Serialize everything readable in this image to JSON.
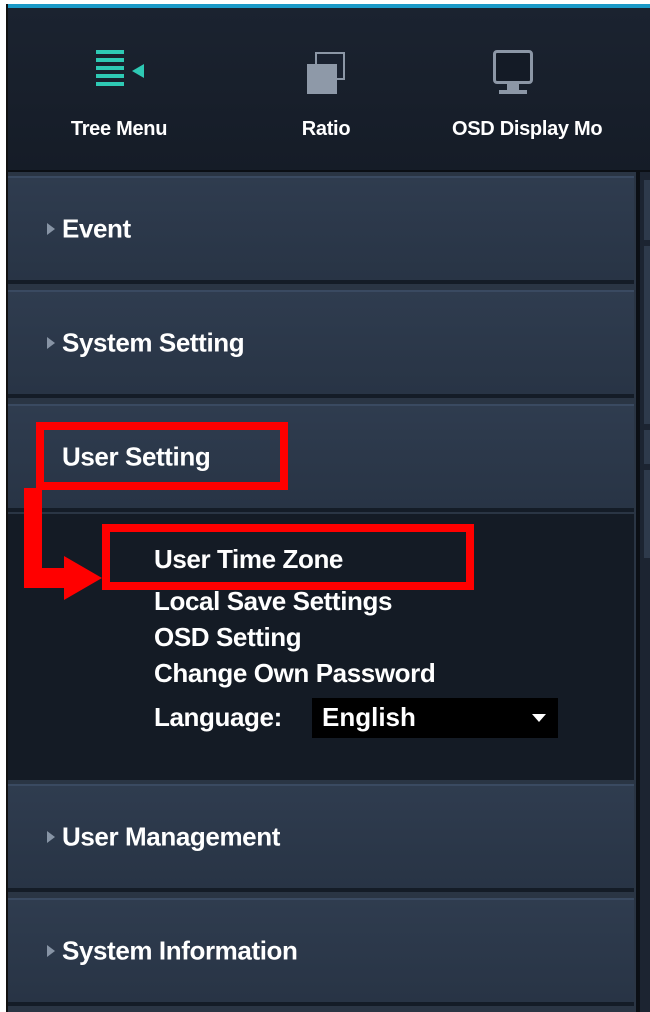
{
  "toolbar": {
    "items": [
      {
        "label": "Tree Menu",
        "icon": "tree-menu-icon"
      },
      {
        "label": "Ratio",
        "icon": "ratio-icon"
      },
      {
        "label": "OSD Display Mo",
        "icon": "monitor-icon"
      }
    ]
  },
  "sidebar": {
    "items": [
      {
        "label": "Event"
      },
      {
        "label": "System Setting"
      },
      {
        "label": "User Setting"
      },
      {
        "label": "User Management"
      },
      {
        "label": "System Information"
      }
    ],
    "user_setting_submenu": [
      {
        "label": "User Time Zone"
      },
      {
        "label": "Local Save Settings"
      },
      {
        "label": "OSD Setting"
      },
      {
        "label": "Change Own Password"
      }
    ],
    "language": {
      "label": "Language:",
      "selected": "English"
    }
  },
  "colors": {
    "accent": "#2ec9b4",
    "highlight": "#ff0000",
    "panel": "#2f3c4f",
    "submenu_bg": "#141b25"
  }
}
